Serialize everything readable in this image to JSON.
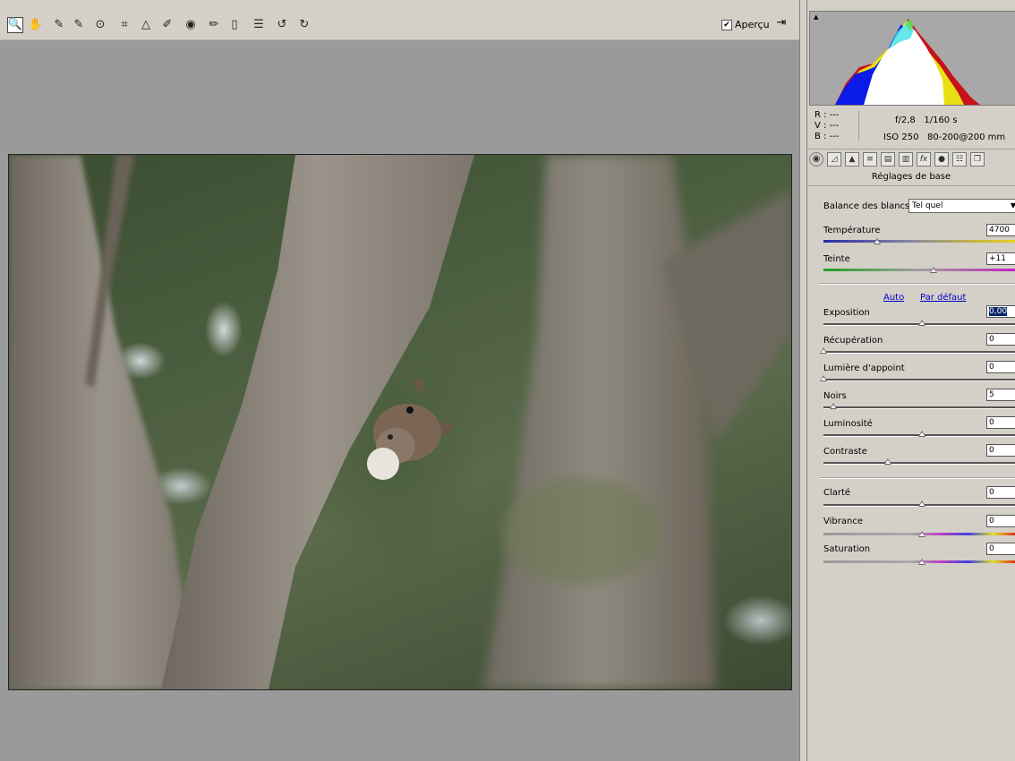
{
  "toolbar": {
    "tools": [
      {
        "icon": "zoom-icon",
        "glyph": "🔍"
      },
      {
        "icon": "hand-icon",
        "glyph": "✋"
      },
      {
        "icon": "white-balance-icon",
        "glyph": "✎"
      },
      {
        "icon": "color-sampler-icon",
        "glyph": "✎"
      },
      {
        "icon": "target-adjust-icon",
        "glyph": "⊙"
      },
      {
        "icon": "crop-icon",
        "glyph": "⌗"
      },
      {
        "icon": "straighten-icon",
        "glyph": "△"
      },
      {
        "icon": "spot-removal-icon",
        "glyph": "✐"
      },
      {
        "icon": "red-eye-icon",
        "glyph": "◉"
      },
      {
        "icon": "adjustment-brush-icon",
        "glyph": "✏"
      },
      {
        "icon": "graduated-filter-icon",
        "glyph": "▯"
      },
      {
        "icon": "preferences-icon",
        "glyph": "☰"
      },
      {
        "icon": "rotate-left-icon",
        "glyph": "↺"
      },
      {
        "icon": "rotate-right-icon",
        "glyph": "↻"
      }
    ],
    "preview_label": "Aperçu",
    "preview_checked": "✔"
  },
  "info": {
    "r": "R : ---",
    "v": "V : ---",
    "b": "B : ---",
    "aperture": "f/2,8",
    "shutter": "1/160 s",
    "iso": "ISO 250",
    "lens": "80-200@200 mm"
  },
  "panel": {
    "title": "Réglages de base",
    "wb_label": "Balance des blancs :",
    "wb_value": "Tel quel",
    "auto_link": "Auto",
    "default_link": "Par défaut",
    "sliders": {
      "temperature": {
        "label": "Température",
        "value": "4700"
      },
      "tint": {
        "label": "Teinte",
        "value": "+11"
      },
      "exposure": {
        "label": "Exposition",
        "value": "0,00"
      },
      "recovery": {
        "label": "Récupération",
        "value": "0"
      },
      "fill_light": {
        "label": "Lumière d'appoint",
        "value": "0"
      },
      "blacks": {
        "label": "Noirs",
        "value": "5"
      },
      "brightness": {
        "label": "Luminosité",
        "value": "0"
      },
      "contrast": {
        "label": "Contraste",
        "value": "0"
      },
      "clarity": {
        "label": "Clarté",
        "value": "0"
      },
      "vibrance": {
        "label": "Vibrance",
        "value": "0"
      },
      "saturation": {
        "label": "Saturation",
        "value": "0"
      }
    }
  },
  "colors": {
    "temp_gradient_start": "#2a2aa8",
    "temp_gradient_end": "#e8d020",
    "tint_gradient_start": "#20a020",
    "tint_gradient_end": "#c020c0",
    "link": "#0000cc",
    "selection": "#0a246a"
  }
}
